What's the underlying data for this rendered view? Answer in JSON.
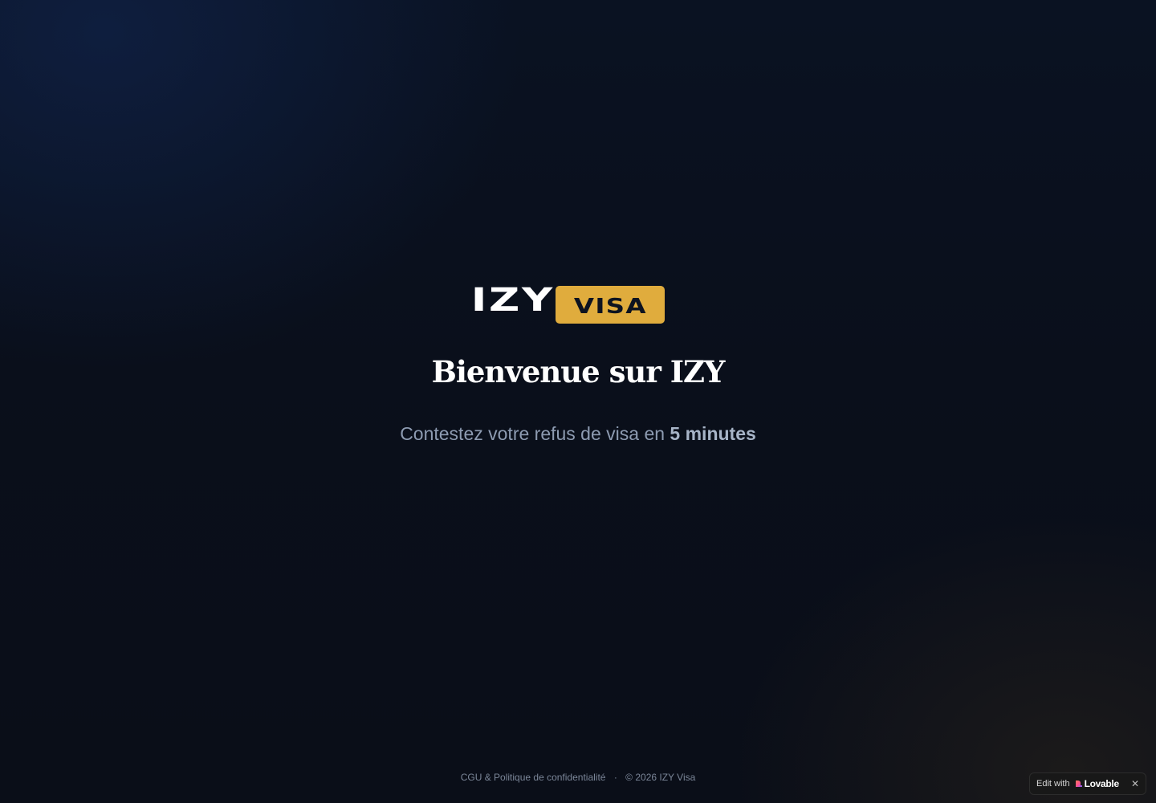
{
  "logo": {
    "word_left": "IZY",
    "word_right": "VISA"
  },
  "hero": {
    "title": "Bienvenue sur IZY",
    "subtitle_prefix": "Contestez votre refus de visa en",
    "subtitle_emphasis": "5 minutes"
  },
  "footer": {
    "legal_link": "CGU & Politique de confidentialité",
    "separator": "·",
    "copyright": "© 2026 IZY Visa"
  },
  "lovable_badge": {
    "edit_with": "Edit with",
    "brand": "Lovable",
    "close_icon": "close-icon",
    "close_glyph": "✕"
  },
  "colors": {
    "background": "#0a0f1a",
    "accent": "#e0ac3d",
    "title": "#ffffff",
    "subtitle": "#8d9bb1",
    "footer": "#7b8698"
  }
}
